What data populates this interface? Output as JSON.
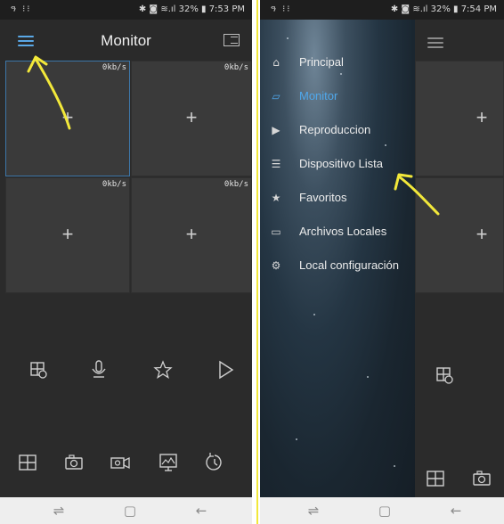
{
  "left_screen": {
    "status": {
      "icons_left": "ዓ ⁝⁝",
      "icons_right": "✱ ◙ ≋.ıl 32% ▮ 7:53 PM"
    },
    "header": {
      "title": "Monitor"
    },
    "cells": [
      {
        "rate": "0kb/s",
        "plus": "+"
      },
      {
        "rate": "0kb/s",
        "plus": "+"
      },
      {
        "rate": "0kb/s",
        "plus": "+"
      },
      {
        "rate": "0kb/s",
        "plus": "+"
      }
    ],
    "controls": {
      "row1": [
        "layout-settings-icon",
        "microphone-icon",
        "star-icon",
        "play-icon"
      ],
      "row2": [
        "grid-icon",
        "camera-snapshot-icon",
        "video-record-icon",
        "image-icon",
        "playback-history-icon"
      ]
    }
  },
  "right_screen": {
    "status": {
      "icons_left": "ዓ ⁝⁝",
      "icons_right": "✱ ◙ ≋.ıl 32% ▮ 7:54 PM"
    },
    "menu": [
      {
        "label": "Principal",
        "icon": "home-icon",
        "glyph": "⌂",
        "active": false
      },
      {
        "label": "Monitor",
        "icon": "monitor-icon",
        "glyph": "▱",
        "active": true
      },
      {
        "label": "Reproduccion",
        "icon": "playback-icon",
        "glyph": "▶",
        "active": false
      },
      {
        "label": "Dispositivo Lista",
        "icon": "device-list-icon",
        "glyph": "☰",
        "active": false
      },
      {
        "label": "Favoritos",
        "icon": "favorites-icon",
        "glyph": "★",
        "active": false
      },
      {
        "label": "Archivos Locales",
        "icon": "folder-icon",
        "glyph": "▭",
        "active": false
      },
      {
        "label": "Local configuración",
        "icon": "settings-icon",
        "glyph": "⚙",
        "active": false
      }
    ],
    "cells": [
      {
        "plus": "+"
      },
      {
        "plus": "+"
      }
    ]
  },
  "nav": {
    "recent": "⇌",
    "home": "▢",
    "back": "←"
  },
  "colors": {
    "accent": "#4fa8ec",
    "annotation": "#f2e83a",
    "panel": "#3a3a3a"
  }
}
